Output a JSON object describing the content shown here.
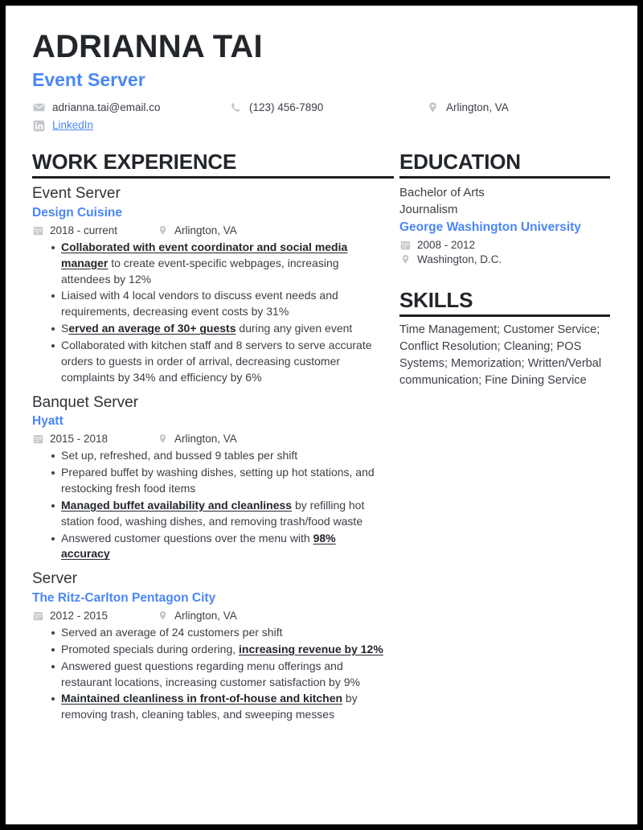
{
  "header": {
    "name": "ADRIANNA TAI",
    "job_title": "Event Server",
    "accent_color": "#4a86f7",
    "text_color": "#23272c",
    "contacts": [
      {
        "icon": "envelope-icon",
        "label": "adrianna.tai@email.co",
        "type": "email"
      },
      {
        "icon": "phone-icon",
        "label": "(123) 456-7890",
        "type": "phone"
      },
      {
        "icon": "location-pin-icon",
        "label": "Arlington, VA",
        "type": "location"
      },
      {
        "icon": "linkedin-icon",
        "label": "LinkedIn",
        "type": "link"
      }
    ]
  },
  "work_experience": {
    "heading": "WORK EXPERIENCE",
    "entries": [
      {
        "title": "Event Server",
        "company": "Design Cuisine",
        "dates": "2018 - current",
        "location": "Arlington, VA",
        "bullets": [
          [
            {
              "text": "Collaborated with event coordinator and social media manager",
              "bold": true
            },
            {
              "text": " to create event-specific webpages, increasing attendees by 12%",
              "bold": false
            }
          ],
          [
            {
              "text": "Liaised with 4 local vendors to discuss event needs and requirements, decreasing event costs by 31%",
              "bold": false
            }
          ],
          [
            {
              "text": "S",
              "bold": false
            },
            {
              "text": "erved an average of 30+ guests",
              "bold": true
            },
            {
              "text": " during any given event",
              "bold": false
            }
          ],
          [
            {
              "text": "Collaborated with kitchen staff and 8 servers to serve accurate orders to guests in order of arrival, decreasing customer complaints by 34% and efficiency by 6%",
              "bold": false
            }
          ]
        ]
      },
      {
        "title": "Banquet Server",
        "company": "Hyatt",
        "dates": "2015 - 2018",
        "location": "Arlington, VA",
        "bullets": [
          [
            {
              "text": "Set up, refreshed, and bussed 9 tables per shift",
              "bold": false
            }
          ],
          [
            {
              "text": "Prepared buffet by washing dishes, setting up hot stations, and restocking fresh food items",
              "bold": false
            }
          ],
          [
            {
              "text": "Managed buffet availability and cleanliness",
              "bold": true
            },
            {
              "text": " by refilling hot station food, washing dishes, and removing trash/food waste",
              "bold": false
            }
          ],
          [
            {
              "text": "Answered customer questions over the menu with ",
              "bold": false
            },
            {
              "text": "98% accuracy",
              "bold": true
            }
          ]
        ]
      },
      {
        "title": "Server",
        "company": "The Ritz-Carlton Pentagon City",
        "dates": "2012 - 2015",
        "location": "Arlington, VA",
        "bullets": [
          [
            {
              "text": "Served an average of 24 customers per shift",
              "bold": false
            }
          ],
          [
            {
              "text": "Promoted specials during ordering, ",
              "bold": false
            },
            {
              "text": "increasing revenue by 12%",
              "bold": true
            }
          ],
          [
            {
              "text": "Answered guest questions regarding menu offerings and restaurant locations, increasing customer satisfaction by 9%",
              "bold": false
            }
          ],
          [
            {
              "text": "Maintained cleanliness in front-of-house and kitchen",
              "bold": true
            },
            {
              "text": " by removing trash, cleaning tables, and sweeping messes",
              "bold": false
            }
          ]
        ]
      }
    ]
  },
  "education": {
    "heading": "EDUCATION",
    "degree": "Bachelor of Arts",
    "field": "Journalism",
    "school": "George Washington University",
    "dates": "2008 - 2012",
    "location": "Washington, D.C."
  },
  "skills": {
    "heading": "SKILLS",
    "text": "Time Management; Customer Service; Conflict Resolution; Cleaning; POS Systems; Memorization; Written/Verbal communication; Fine Dining Service"
  }
}
